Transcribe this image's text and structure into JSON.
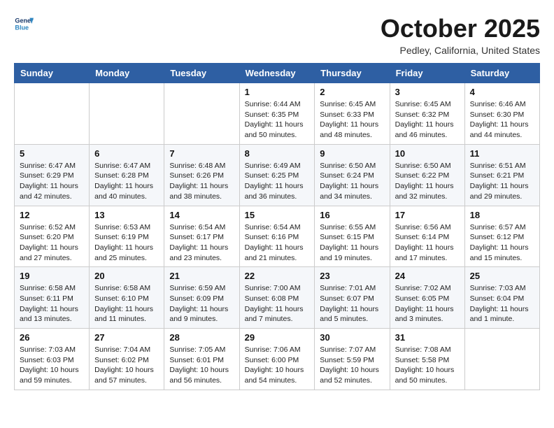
{
  "header": {
    "logo_line1": "General",
    "logo_line2": "Blue",
    "month": "October 2025",
    "location": "Pedley, California, United States"
  },
  "days_of_week": [
    "Sunday",
    "Monday",
    "Tuesday",
    "Wednesday",
    "Thursday",
    "Friday",
    "Saturday"
  ],
  "weeks": [
    [
      {
        "day": "",
        "info": ""
      },
      {
        "day": "",
        "info": ""
      },
      {
        "day": "",
        "info": ""
      },
      {
        "day": "1",
        "info": "Sunrise: 6:44 AM\nSunset: 6:35 PM\nDaylight: 11 hours\nand 50 minutes."
      },
      {
        "day": "2",
        "info": "Sunrise: 6:45 AM\nSunset: 6:33 PM\nDaylight: 11 hours\nand 48 minutes."
      },
      {
        "day": "3",
        "info": "Sunrise: 6:45 AM\nSunset: 6:32 PM\nDaylight: 11 hours\nand 46 minutes."
      },
      {
        "day": "4",
        "info": "Sunrise: 6:46 AM\nSunset: 6:30 PM\nDaylight: 11 hours\nand 44 minutes."
      }
    ],
    [
      {
        "day": "5",
        "info": "Sunrise: 6:47 AM\nSunset: 6:29 PM\nDaylight: 11 hours\nand 42 minutes."
      },
      {
        "day": "6",
        "info": "Sunrise: 6:47 AM\nSunset: 6:28 PM\nDaylight: 11 hours\nand 40 minutes."
      },
      {
        "day": "7",
        "info": "Sunrise: 6:48 AM\nSunset: 6:26 PM\nDaylight: 11 hours\nand 38 minutes."
      },
      {
        "day": "8",
        "info": "Sunrise: 6:49 AM\nSunset: 6:25 PM\nDaylight: 11 hours\nand 36 minutes."
      },
      {
        "day": "9",
        "info": "Sunrise: 6:50 AM\nSunset: 6:24 PM\nDaylight: 11 hours\nand 34 minutes."
      },
      {
        "day": "10",
        "info": "Sunrise: 6:50 AM\nSunset: 6:22 PM\nDaylight: 11 hours\nand 32 minutes."
      },
      {
        "day": "11",
        "info": "Sunrise: 6:51 AM\nSunset: 6:21 PM\nDaylight: 11 hours\nand 29 minutes."
      }
    ],
    [
      {
        "day": "12",
        "info": "Sunrise: 6:52 AM\nSunset: 6:20 PM\nDaylight: 11 hours\nand 27 minutes."
      },
      {
        "day": "13",
        "info": "Sunrise: 6:53 AM\nSunset: 6:19 PM\nDaylight: 11 hours\nand 25 minutes."
      },
      {
        "day": "14",
        "info": "Sunrise: 6:54 AM\nSunset: 6:17 PM\nDaylight: 11 hours\nand 23 minutes."
      },
      {
        "day": "15",
        "info": "Sunrise: 6:54 AM\nSunset: 6:16 PM\nDaylight: 11 hours\nand 21 minutes."
      },
      {
        "day": "16",
        "info": "Sunrise: 6:55 AM\nSunset: 6:15 PM\nDaylight: 11 hours\nand 19 minutes."
      },
      {
        "day": "17",
        "info": "Sunrise: 6:56 AM\nSunset: 6:14 PM\nDaylight: 11 hours\nand 17 minutes."
      },
      {
        "day": "18",
        "info": "Sunrise: 6:57 AM\nSunset: 6:12 PM\nDaylight: 11 hours\nand 15 minutes."
      }
    ],
    [
      {
        "day": "19",
        "info": "Sunrise: 6:58 AM\nSunset: 6:11 PM\nDaylight: 11 hours\nand 13 minutes."
      },
      {
        "day": "20",
        "info": "Sunrise: 6:58 AM\nSunset: 6:10 PM\nDaylight: 11 hours\nand 11 minutes."
      },
      {
        "day": "21",
        "info": "Sunrise: 6:59 AM\nSunset: 6:09 PM\nDaylight: 11 hours\nand 9 minutes."
      },
      {
        "day": "22",
        "info": "Sunrise: 7:00 AM\nSunset: 6:08 PM\nDaylight: 11 hours\nand 7 minutes."
      },
      {
        "day": "23",
        "info": "Sunrise: 7:01 AM\nSunset: 6:07 PM\nDaylight: 11 hours\nand 5 minutes."
      },
      {
        "day": "24",
        "info": "Sunrise: 7:02 AM\nSunset: 6:05 PM\nDaylight: 11 hours\nand 3 minutes."
      },
      {
        "day": "25",
        "info": "Sunrise: 7:03 AM\nSunset: 6:04 PM\nDaylight: 11 hours\nand 1 minute."
      }
    ],
    [
      {
        "day": "26",
        "info": "Sunrise: 7:03 AM\nSunset: 6:03 PM\nDaylight: 10 hours\nand 59 minutes."
      },
      {
        "day": "27",
        "info": "Sunrise: 7:04 AM\nSunset: 6:02 PM\nDaylight: 10 hours\nand 57 minutes."
      },
      {
        "day": "28",
        "info": "Sunrise: 7:05 AM\nSunset: 6:01 PM\nDaylight: 10 hours\nand 56 minutes."
      },
      {
        "day": "29",
        "info": "Sunrise: 7:06 AM\nSunset: 6:00 PM\nDaylight: 10 hours\nand 54 minutes."
      },
      {
        "day": "30",
        "info": "Sunrise: 7:07 AM\nSunset: 5:59 PM\nDaylight: 10 hours\nand 52 minutes."
      },
      {
        "day": "31",
        "info": "Sunrise: 7:08 AM\nSunset: 5:58 PM\nDaylight: 10 hours\nand 50 minutes."
      },
      {
        "day": "",
        "info": ""
      }
    ]
  ]
}
